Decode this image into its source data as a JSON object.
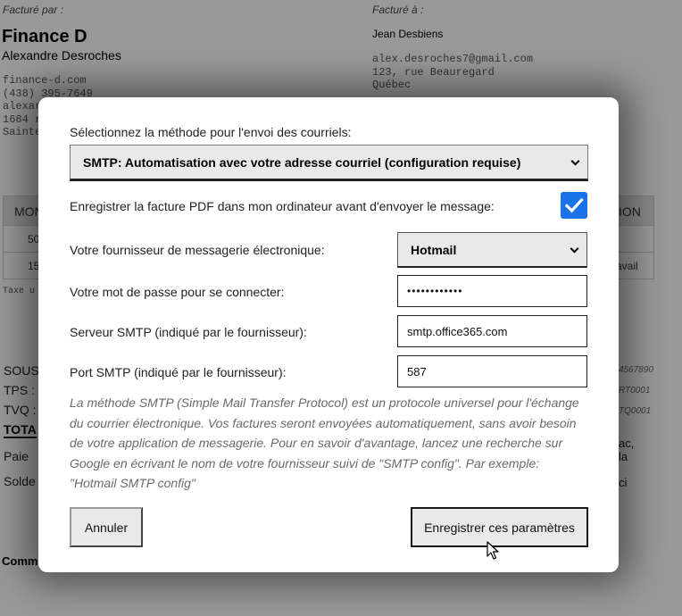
{
  "invoice": {
    "billed_by_label": "Facturé par :",
    "billed_to_label": "Facturé à :",
    "company": "Finance D",
    "owner": "Alexandre Desroches",
    "sender_lines": [
      "finance-d.com",
      "(438) 395-7649",
      "alexar",
      "1684 r",
      "Sainte"
    ],
    "client_name": "Jean Desbiens",
    "client_lines": [
      "alex.desroches7@gmail.com",
      "123, rue Beauregard",
      "Québec"
    ],
    "table": {
      "header_left": "MON",
      "header_right": "ION",
      "rows": [
        {
          "left": "50",
          "right": ""
        },
        {
          "left": "15",
          "right": "avail"
        }
      ]
    },
    "taxe_note": "Taxe u",
    "totals": {
      "sous": "SOUS",
      "tps": "TPS :",
      "tvq": "TVQ :",
      "total": "TOTA",
      "paiement": "Paie",
      "solde": "Solde"
    },
    "right_small": [
      "4567890",
      "RT0001",
      "TQ0001"
    ],
    "right_frag": [
      "ac,",
      "la",
      "ci"
    ],
    "comment": "Comm"
  },
  "modal": {
    "method_label": "Sélectionnez la méthode pour l'envoi des courriels:",
    "method_value": "SMTP: Automatisation avec votre adresse courriel (configuration requise)",
    "save_pdf_label": "Enregistrer la facture PDF dans mon ordinateur avant d'envoyer le message:",
    "save_pdf_checked": true,
    "provider_label": "Votre fournisseur de messagerie électronique:",
    "provider_value": "Hotmail",
    "password_label": "Votre mot de passe pour se connecter:",
    "password_value": "••••••••••••",
    "server_label": "Serveur SMTP (indiqué par le fournisseur):",
    "server_value": "smtp.office365.com",
    "port_label": "Port SMTP (indiqué par le fournisseur):",
    "port_value": "587",
    "info_text": "La méthode SMTP (Simple Mail Transfer Protocol) est un protocole universel pour l'échange du courrier électronique. Vos factures seront envoyées automatiquement, sans avoir besoin de votre application de messagerie. Pour en savoir d'avantage, lancez une recherche sur Google en écrivant le nom de votre fournisseur suivi de \"SMTP config\". Par exemple: \"Hotmail SMTP config\"",
    "cancel_label": "Annuler",
    "save_label": "Enregistrer ces paramètres",
    "accent_color": "#1a73e8"
  }
}
